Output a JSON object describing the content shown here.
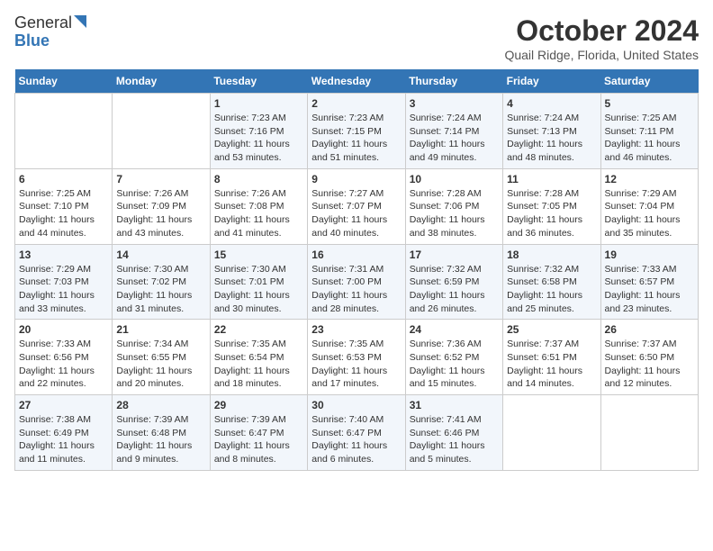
{
  "logo": {
    "general": "General",
    "blue": "Blue"
  },
  "title": "October 2024",
  "subtitle": "Quail Ridge, Florida, United States",
  "days_of_week": [
    "Sunday",
    "Monday",
    "Tuesday",
    "Wednesday",
    "Thursday",
    "Friday",
    "Saturday"
  ],
  "weeks": [
    [
      {
        "day": "",
        "content": ""
      },
      {
        "day": "",
        "content": ""
      },
      {
        "day": "1",
        "content": "Sunrise: 7:23 AM\nSunset: 7:16 PM\nDaylight: 11 hours and 53 minutes."
      },
      {
        "day": "2",
        "content": "Sunrise: 7:23 AM\nSunset: 7:15 PM\nDaylight: 11 hours and 51 minutes."
      },
      {
        "day": "3",
        "content": "Sunrise: 7:24 AM\nSunset: 7:14 PM\nDaylight: 11 hours and 49 minutes."
      },
      {
        "day": "4",
        "content": "Sunrise: 7:24 AM\nSunset: 7:13 PM\nDaylight: 11 hours and 48 minutes."
      },
      {
        "day": "5",
        "content": "Sunrise: 7:25 AM\nSunset: 7:11 PM\nDaylight: 11 hours and 46 minutes."
      }
    ],
    [
      {
        "day": "6",
        "content": "Sunrise: 7:25 AM\nSunset: 7:10 PM\nDaylight: 11 hours and 44 minutes."
      },
      {
        "day": "7",
        "content": "Sunrise: 7:26 AM\nSunset: 7:09 PM\nDaylight: 11 hours and 43 minutes."
      },
      {
        "day": "8",
        "content": "Sunrise: 7:26 AM\nSunset: 7:08 PM\nDaylight: 11 hours and 41 minutes."
      },
      {
        "day": "9",
        "content": "Sunrise: 7:27 AM\nSunset: 7:07 PM\nDaylight: 11 hours and 40 minutes."
      },
      {
        "day": "10",
        "content": "Sunrise: 7:28 AM\nSunset: 7:06 PM\nDaylight: 11 hours and 38 minutes."
      },
      {
        "day": "11",
        "content": "Sunrise: 7:28 AM\nSunset: 7:05 PM\nDaylight: 11 hours and 36 minutes."
      },
      {
        "day": "12",
        "content": "Sunrise: 7:29 AM\nSunset: 7:04 PM\nDaylight: 11 hours and 35 minutes."
      }
    ],
    [
      {
        "day": "13",
        "content": "Sunrise: 7:29 AM\nSunset: 7:03 PM\nDaylight: 11 hours and 33 minutes."
      },
      {
        "day": "14",
        "content": "Sunrise: 7:30 AM\nSunset: 7:02 PM\nDaylight: 11 hours and 31 minutes."
      },
      {
        "day": "15",
        "content": "Sunrise: 7:30 AM\nSunset: 7:01 PM\nDaylight: 11 hours and 30 minutes."
      },
      {
        "day": "16",
        "content": "Sunrise: 7:31 AM\nSunset: 7:00 PM\nDaylight: 11 hours and 28 minutes."
      },
      {
        "day": "17",
        "content": "Sunrise: 7:32 AM\nSunset: 6:59 PM\nDaylight: 11 hours and 26 minutes."
      },
      {
        "day": "18",
        "content": "Sunrise: 7:32 AM\nSunset: 6:58 PM\nDaylight: 11 hours and 25 minutes."
      },
      {
        "day": "19",
        "content": "Sunrise: 7:33 AM\nSunset: 6:57 PM\nDaylight: 11 hours and 23 minutes."
      }
    ],
    [
      {
        "day": "20",
        "content": "Sunrise: 7:33 AM\nSunset: 6:56 PM\nDaylight: 11 hours and 22 minutes."
      },
      {
        "day": "21",
        "content": "Sunrise: 7:34 AM\nSunset: 6:55 PM\nDaylight: 11 hours and 20 minutes."
      },
      {
        "day": "22",
        "content": "Sunrise: 7:35 AM\nSunset: 6:54 PM\nDaylight: 11 hours and 18 minutes."
      },
      {
        "day": "23",
        "content": "Sunrise: 7:35 AM\nSunset: 6:53 PM\nDaylight: 11 hours and 17 minutes."
      },
      {
        "day": "24",
        "content": "Sunrise: 7:36 AM\nSunset: 6:52 PM\nDaylight: 11 hours and 15 minutes."
      },
      {
        "day": "25",
        "content": "Sunrise: 7:37 AM\nSunset: 6:51 PM\nDaylight: 11 hours and 14 minutes."
      },
      {
        "day": "26",
        "content": "Sunrise: 7:37 AM\nSunset: 6:50 PM\nDaylight: 11 hours and 12 minutes."
      }
    ],
    [
      {
        "day": "27",
        "content": "Sunrise: 7:38 AM\nSunset: 6:49 PM\nDaylight: 11 hours and 11 minutes."
      },
      {
        "day": "28",
        "content": "Sunrise: 7:39 AM\nSunset: 6:48 PM\nDaylight: 11 hours and 9 minutes."
      },
      {
        "day": "29",
        "content": "Sunrise: 7:39 AM\nSunset: 6:47 PM\nDaylight: 11 hours and 8 minutes."
      },
      {
        "day": "30",
        "content": "Sunrise: 7:40 AM\nSunset: 6:47 PM\nDaylight: 11 hours and 6 minutes."
      },
      {
        "day": "31",
        "content": "Sunrise: 7:41 AM\nSunset: 6:46 PM\nDaylight: 11 hours and 5 minutes."
      },
      {
        "day": "",
        "content": ""
      },
      {
        "day": "",
        "content": ""
      }
    ]
  ]
}
